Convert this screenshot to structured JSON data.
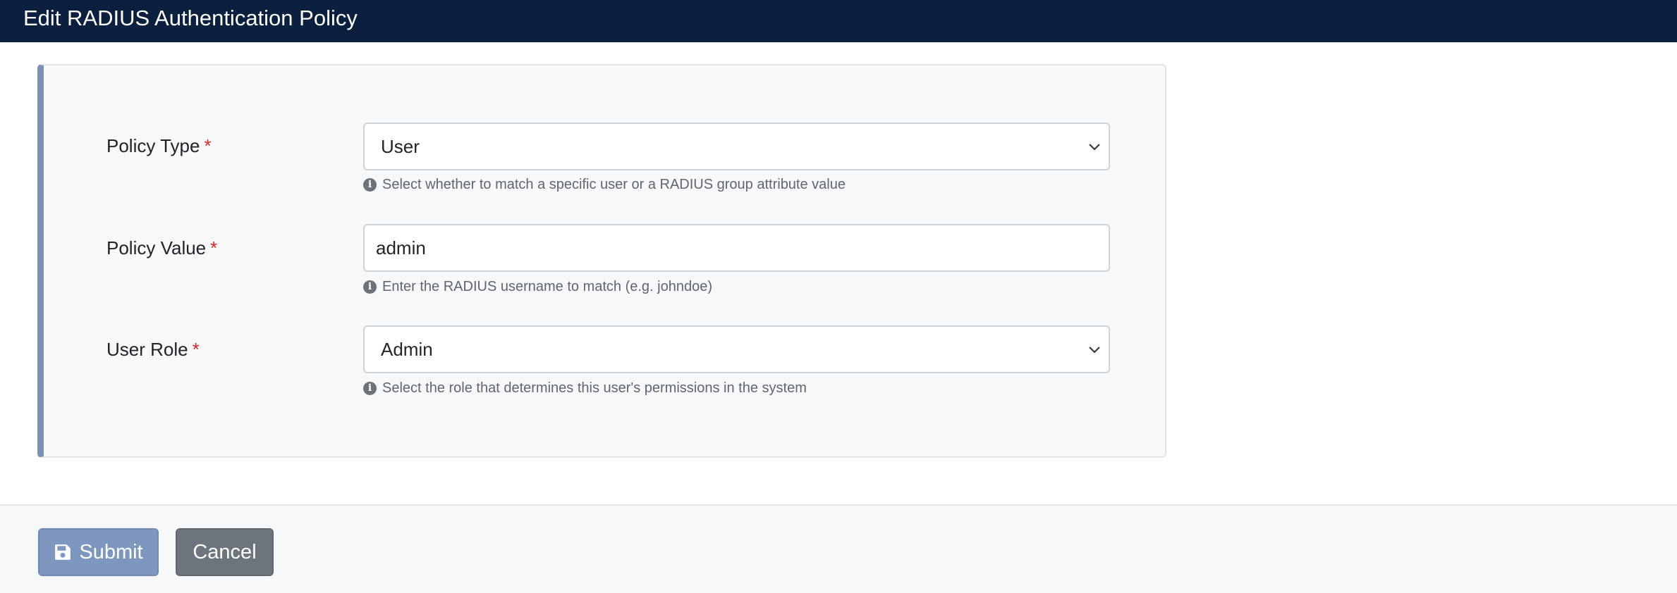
{
  "header": {
    "title": "Edit RADIUS Authentication Policy"
  },
  "form": {
    "required_marker": "*",
    "policy_type": {
      "label": "Policy Type",
      "value": "User",
      "help": "Select whether to match a specific user or a RADIUS group attribute value"
    },
    "policy_value": {
      "label": "Policy Value",
      "value": "admin",
      "help": "Enter the RADIUS username to match (e.g. johndoe)"
    },
    "user_role": {
      "label": "User Role",
      "value": "Admin",
      "help": "Select the role that determines this user's permissions in the system"
    }
  },
  "footer": {
    "submit_label": "Submit",
    "cancel_label": "Cancel"
  },
  "icons": {
    "info": "info-circle-icon",
    "chevron": "chevron-down-icon",
    "save": "floppy-disk-icon"
  },
  "colors": {
    "header_bg": "#0b1f3f",
    "card_accent": "#7a92b8",
    "required": "#dc2626",
    "submit_bg": "#7d97c1",
    "cancel_bg": "#6c757d"
  }
}
